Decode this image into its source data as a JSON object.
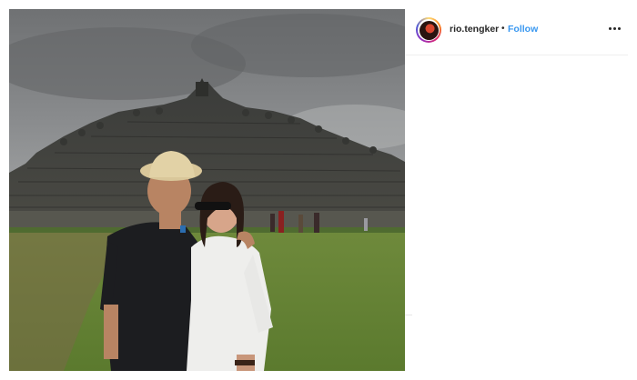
{
  "post": {
    "username": "rio.tengker",
    "separator": "•",
    "follow_label": "Follow",
    "more_icon": "more-horizontal-icon",
    "avatar_icon": "profile-avatar"
  },
  "colors": {
    "follow": "#3897f0",
    "text": "#262626",
    "divider": "#efefef"
  }
}
